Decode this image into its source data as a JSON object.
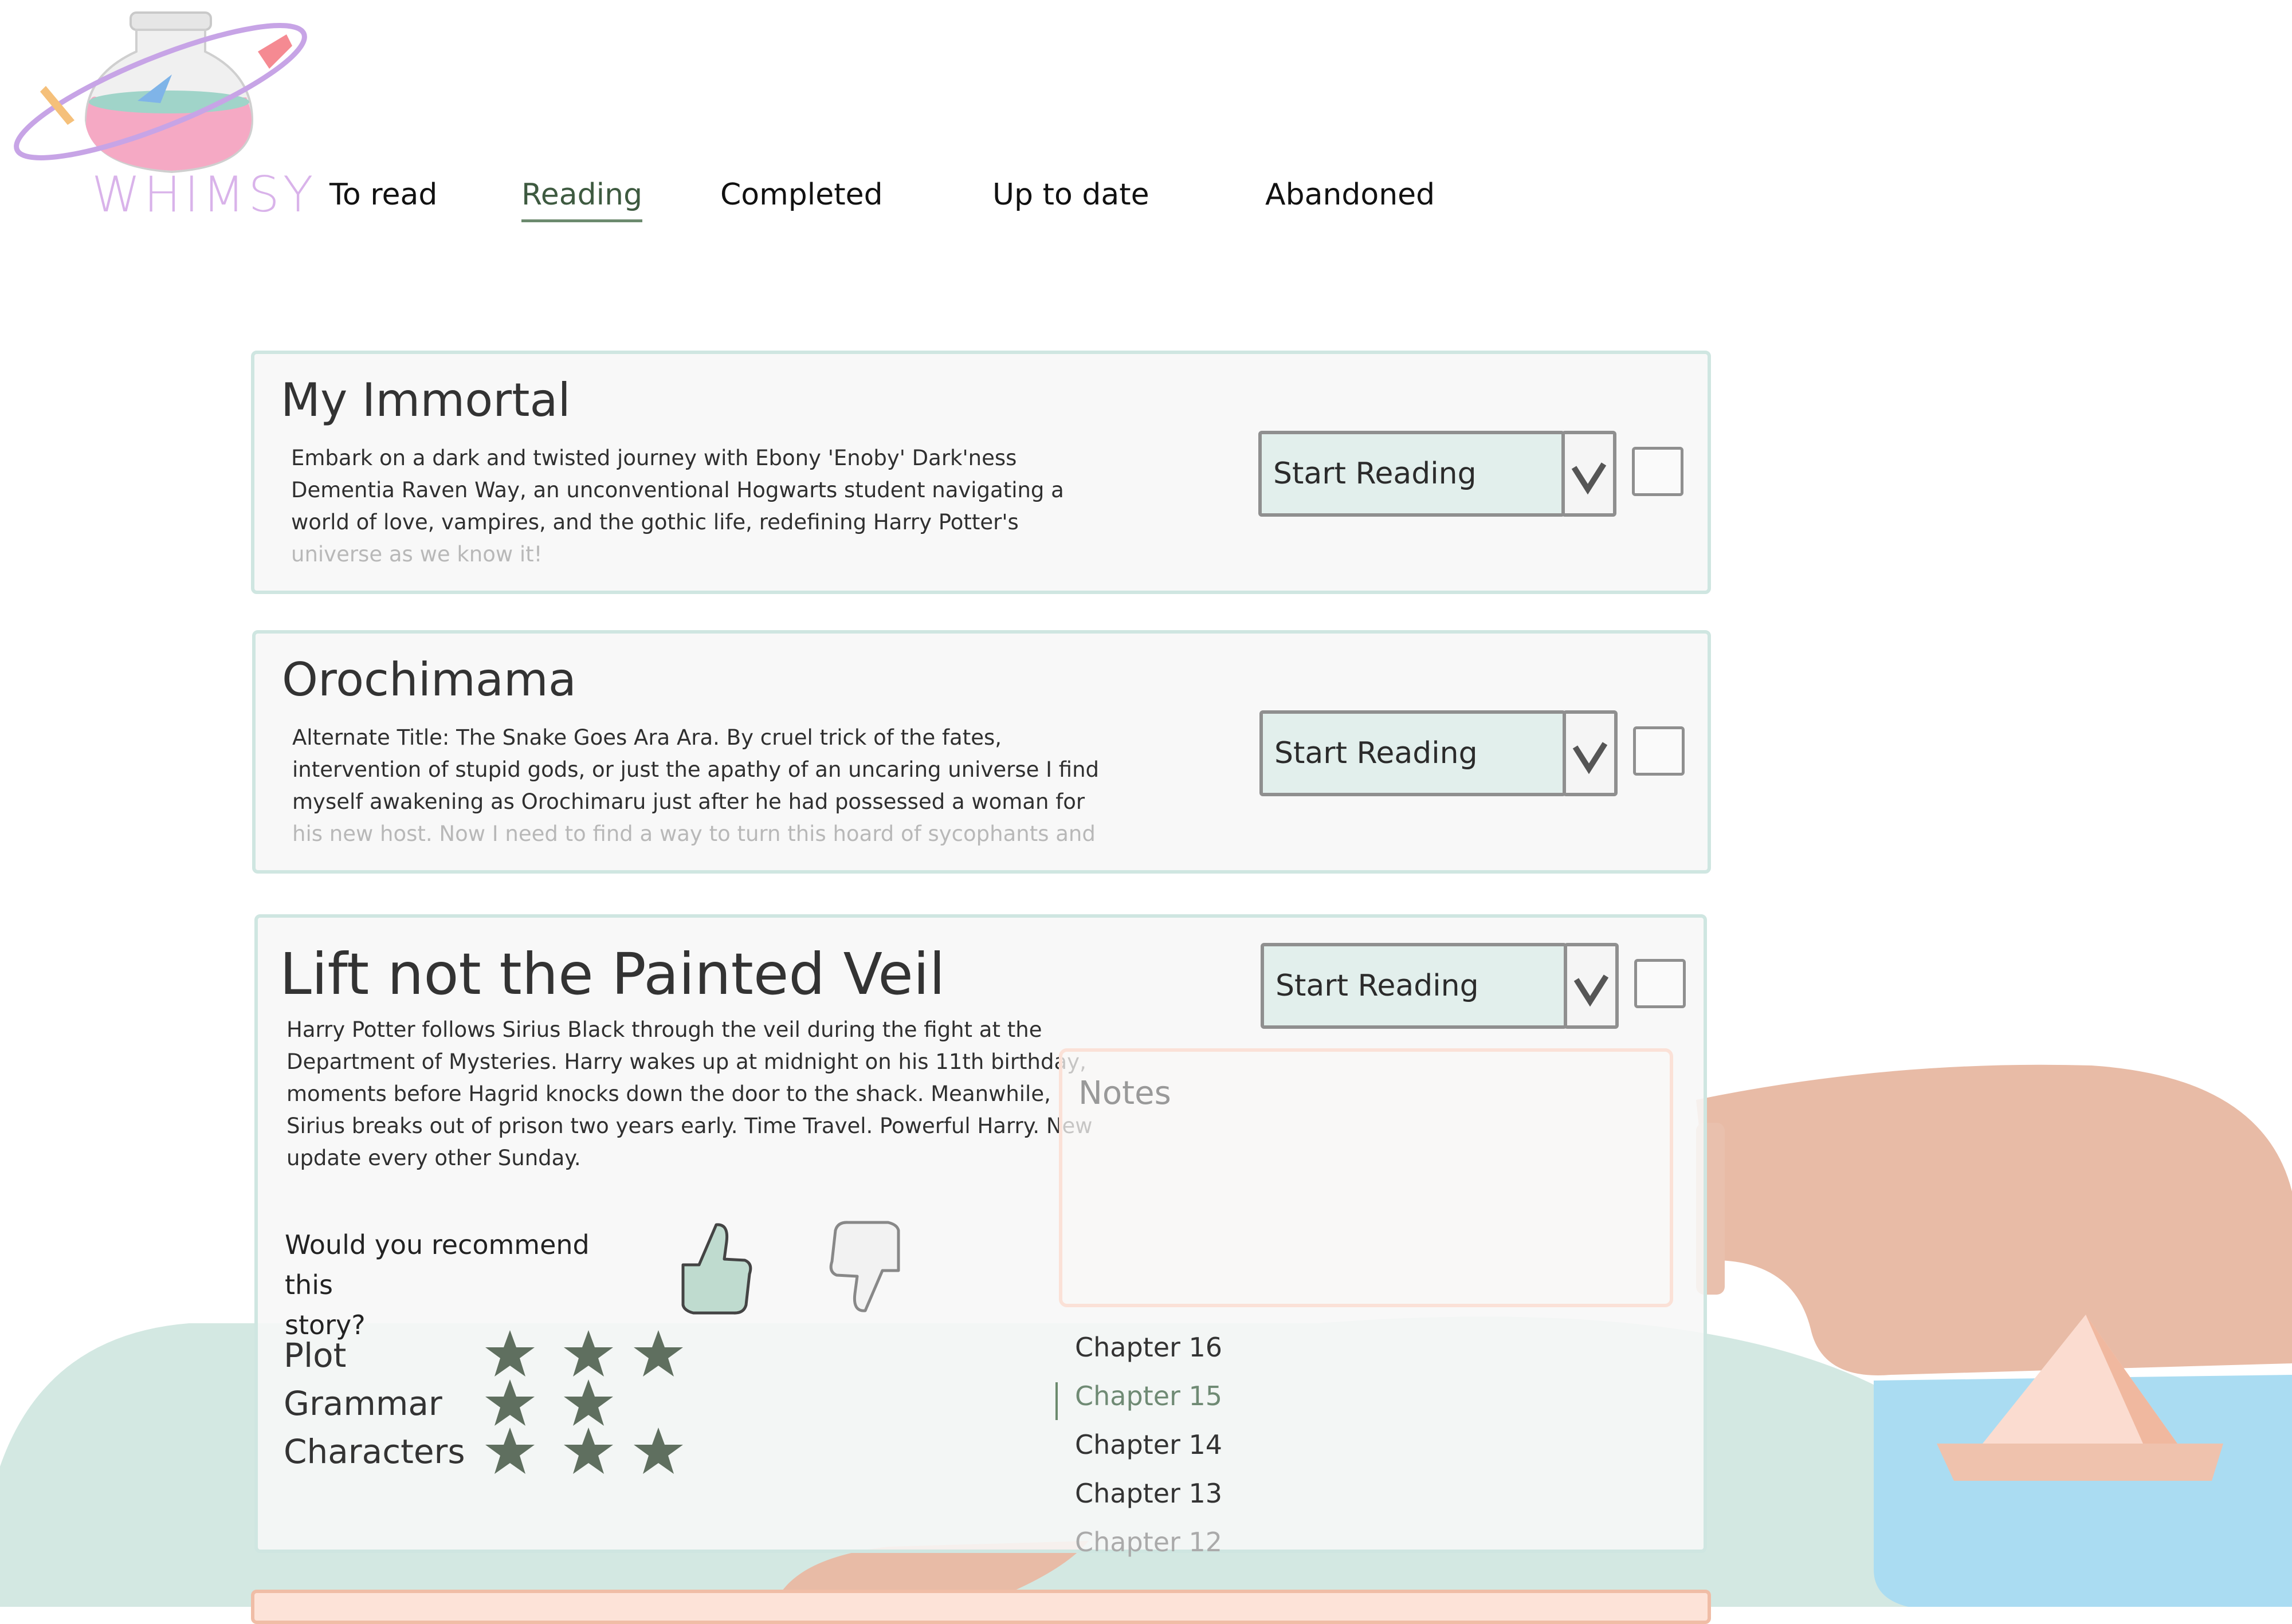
{
  "brand": {
    "logo_text": "WHIMSY"
  },
  "nav": {
    "tabs": [
      {
        "label": "To read",
        "active": false
      },
      {
        "label": "Reading",
        "active": true
      },
      {
        "label": "Completed",
        "active": false
      },
      {
        "label": "Up to date",
        "active": false
      },
      {
        "label": "Abandoned",
        "active": false
      }
    ]
  },
  "stories": [
    {
      "title": "My Immortal",
      "description_lines": [
        "Embark on a dark and twisted journey with Ebony 'Enoby' Dark'ness",
        "Dementia Raven Way, an unconventional Hogwarts student navigating a",
        "world of love, vampires, and the gothic life, redefining Harry Potter's",
        "universe as we know it!"
      ],
      "status": "Start Reading"
    },
    {
      "title": "Orochimama",
      "description_lines": [
        "Alternate Title: The Snake Goes Ara Ara. By cruel trick of the fates,",
        "intervention of stupid gods, or just the apathy of an uncaring universe I find",
        "myself awakening as Orochimaru just after he had possessed a woman for",
        "his new host. Now I need to find a way to turn this hoard of sycophants and"
      ],
      "status": "Start Reading"
    },
    {
      "title": "Lift not the Painted Veil",
      "description_lines": [
        "Harry Potter follows Sirius Black through the veil during the fight at the",
        "Department of Mysteries. Harry wakes up at midnight on his 11th birthday,",
        "moments before Hagrid knocks down the door to the shack. Meanwhile,",
        "Sirius breaks out of prison two years early. Time Travel. Powerful Harry. New",
        "update every other Sunday."
      ],
      "status": "Start Reading",
      "recommend_question_line1": "Would you recommend this",
      "recommend_question_line2": "story?",
      "recommend": "yes",
      "notes_placeholder": "Notes",
      "ratings": [
        {
          "label": "Plot",
          "stars": 3
        },
        {
          "label": "Grammar",
          "stars": 2
        },
        {
          "label": "Characters",
          "stars": 3
        }
      ],
      "chapters": [
        {
          "label": "Chapter 16",
          "state": "normal"
        },
        {
          "label": "Chapter 15",
          "state": "current"
        },
        {
          "label": "Chapter 14",
          "state": "normal"
        },
        {
          "label": "Chapter 13",
          "state": "normal"
        },
        {
          "label": "Chapter 12",
          "state": "faded"
        }
      ]
    }
  ],
  "colors": {
    "accent_green": "#5f6f5f",
    "card_border": "#cfe6e1",
    "select_fill": "#e2efec",
    "peach": "#e8bba6",
    "water": "#a9dcf2",
    "mint": "#cfe6e1"
  }
}
